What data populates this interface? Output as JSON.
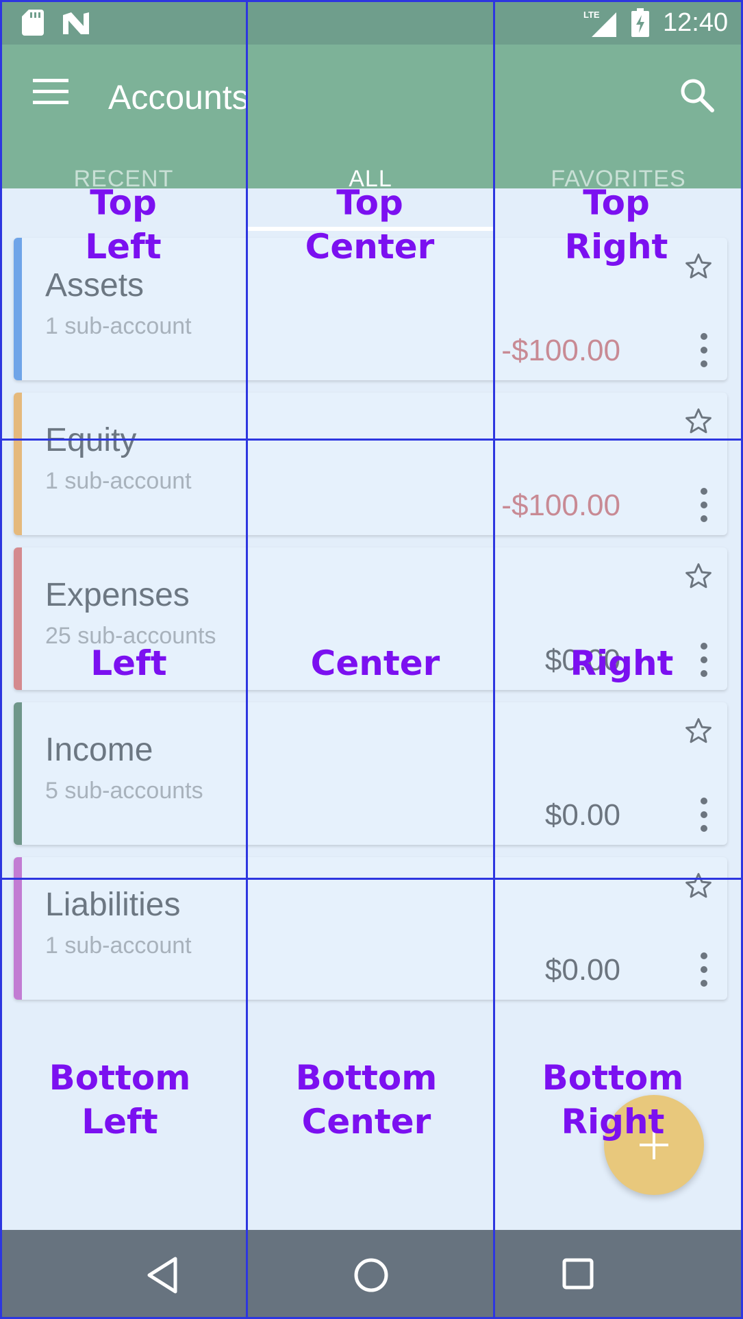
{
  "status_bar": {
    "time": "12:40",
    "network": "LTE"
  },
  "toolbar": {
    "title": "Accounts"
  },
  "tabs": [
    {
      "label": "RECENT",
      "active": false
    },
    {
      "label": "ALL",
      "active": true
    },
    {
      "label": "FAVORITES",
      "active": false
    }
  ],
  "accounts": [
    {
      "name": "Assets",
      "sub": "1 sub-account",
      "balance": "-$100.00",
      "negative": true,
      "color": "#6fa4e8"
    },
    {
      "name": "Equity",
      "sub": "1 sub-account",
      "balance": "-$100.00",
      "negative": true,
      "color": "#e5b97c"
    },
    {
      "name": "Expenses",
      "sub": "25 sub-accounts",
      "balance": "$0.00",
      "negative": false,
      "color": "#d48a8f"
    },
    {
      "name": "Income",
      "sub": "5 sub-accounts",
      "balance": "$0.00",
      "negative": false,
      "color": "#6f968a"
    },
    {
      "name": "Liabilities",
      "sub": "1 sub-account",
      "balance": "$0.00",
      "negative": false,
      "color": "#c27cd3"
    }
  ],
  "grid_labels": {
    "top_left": "Top\nLeft",
    "top_center": "Top\nCenter",
    "top_right": "Top\nRight",
    "left": "Left",
    "center": "Center",
    "right": "Right",
    "bottom_left": "Bottom\nLeft",
    "bottom_center": "Bottom\nCenter",
    "bottom_right": "Bottom\nRight"
  },
  "colors": {
    "status_bar": "#6f9e8c",
    "toolbar": "#7db298",
    "background": "#e3eefa",
    "fab": "#e8c87c",
    "nav_bar": "#67737f",
    "grid": "#2d36e0",
    "grid_label": "#7b10f0"
  },
  "icons": [
    "sd-card-icon",
    "n-logo-icon",
    "lte-signal-icon",
    "battery-charging-icon",
    "menu-icon",
    "search-icon",
    "star-outline-icon",
    "more-vert-icon",
    "plus-icon",
    "back-icon",
    "home-icon",
    "recents-icon"
  ]
}
